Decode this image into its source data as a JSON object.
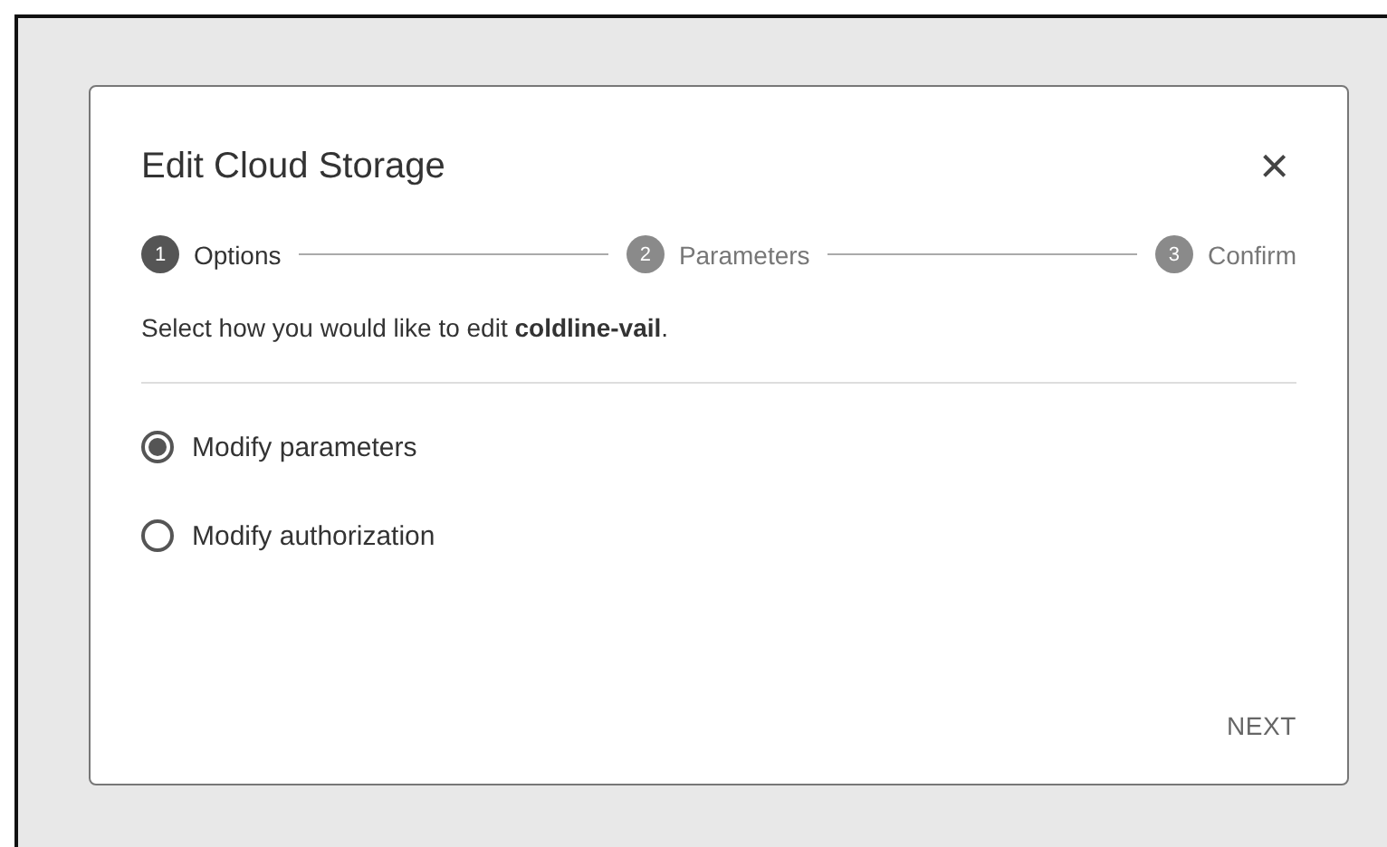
{
  "dialog": {
    "title": "Edit Cloud Storage",
    "close": "×",
    "steps": [
      {
        "number": "1",
        "label": "Options",
        "selected": true
      },
      {
        "number": "2",
        "label": "Parameters",
        "selected": false
      },
      {
        "number": "3",
        "label": "Confirm",
        "selected": false
      }
    ],
    "description": "Select how you would like to edit **coldline-vail**.",
    "options": [
      {
        "label": "Modify parameters",
        "selected": true
      },
      {
        "label": "Modify authorization",
        "selected": false
      }
    ],
    "next_button": "NEXT"
  }
}
